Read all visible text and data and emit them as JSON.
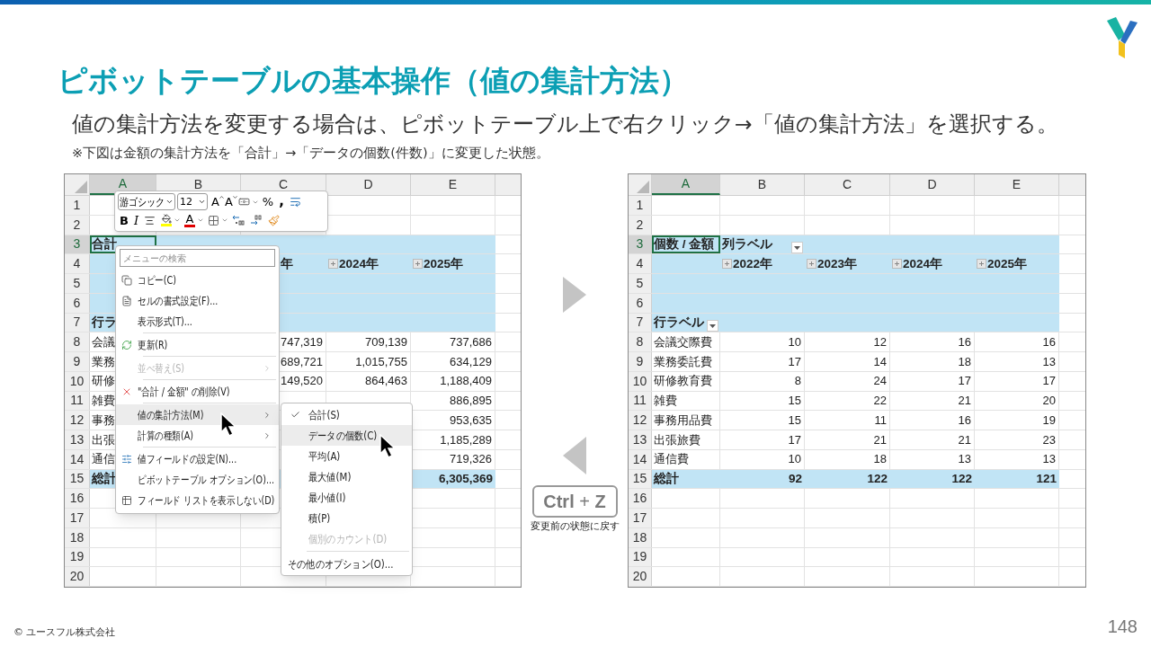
{
  "slide": {
    "title": "ピボットテーブルの基本操作（値の集計方法）",
    "subtitle": "値の集計方法を変更する場合は、ピボットテーブル上で右クリック→「値の集計方法」を選択する。",
    "note": "※下図は金額の集計方法を「合計」→「データの個数(件数)」に変更した状態。",
    "undo_key": "**Ctrl** + **Z**",
    "undo_caption": "変更前の状態に戻す",
    "footer": "© ユースフル株式会社",
    "page": "148"
  },
  "before": {
    "columns": [
      {
        "label": "A",
        "selected": true
      },
      {
        "label": "B",
        "selected": false
      },
      {
        "label": "C",
        "selected": false
      },
      {
        "label": "D",
        "selected": false
      },
      {
        "label": "E",
        "selected": false
      }
    ],
    "rows": [
      {
        "number": "1",
        "selected": false,
        "kind": "blank",
        "cells": [
          null,
          null,
          null,
          null,
          null
        ]
      },
      {
        "number": "2",
        "selected": false,
        "kind": "blank",
        "cells": [
          null,
          null,
          null,
          null,
          null
        ]
      },
      {
        "number": "3",
        "selected": true,
        "kind": "pivot",
        "cells": [
          {
            "text": "合計",
            "active": true
          },
          null,
          null,
          null,
          null
        ]
      },
      {
        "number": "4",
        "selected": false,
        "kind": "pivot",
        "cells": [
          null,
          null,
          {
            "text": "年",
            "kind": "clipped"
          },
          {
            "text": "2024年",
            "expander": true
          },
          {
            "text": "2025年",
            "expander": true
          }
        ]
      },
      {
        "number": "5",
        "selected": false,
        "kind": "pivot",
        "cells": [
          null,
          null,
          null,
          null,
          null
        ]
      },
      {
        "number": "6",
        "selected": false,
        "kind": "pivot",
        "cells": [
          null,
          null,
          null,
          null,
          null
        ]
      },
      {
        "number": "7",
        "selected": false,
        "kind": "pivot",
        "cells": [
          "行ラ",
          null,
          null,
          null,
          null
        ]
      },
      {
        "number": "8",
        "selected": false,
        "kind": "data",
        "cells": [
          "会議",
          null,
          "747,319",
          "709,139",
          "737,686"
        ]
      },
      {
        "number": "9",
        "selected": false,
        "kind": "data",
        "cells": [
          "業務",
          null,
          "689,721",
          "1,015,755",
          "634,129"
        ]
      },
      {
        "number": "10",
        "selected": false,
        "kind": "data",
        "cells": [
          "研修",
          null,
          "149,520",
          "864,463",
          "1,188,409"
        ]
      },
      {
        "number": "11",
        "selected": false,
        "kind": "data",
        "cells": [
          "雑費",
          null,
          null,
          null,
          "886,895"
        ]
      },
      {
        "number": "12",
        "selected": false,
        "kind": "data",
        "cells": [
          "事務",
          null,
          null,
          null,
          "953,635"
        ]
      },
      {
        "number": "13",
        "selected": false,
        "kind": "data",
        "cells": [
          "出張",
          null,
          null,
          null,
          "1,185,289"
        ]
      },
      {
        "number": "14",
        "selected": false,
        "kind": "data",
        "cells": [
          "通信",
          null,
          null,
          null,
          "719,326"
        ]
      },
      {
        "number": "15",
        "selected": false,
        "kind": "total",
        "cells": [
          "総計",
          null,
          null,
          null,
          "6,305,369"
        ]
      },
      {
        "number": "16",
        "selected": false,
        "kind": "blank",
        "cells": [
          null,
          null,
          null,
          null,
          null
        ]
      },
      {
        "number": "17",
        "selected": false,
        "kind": "blank",
        "cells": [
          null,
          null,
          null,
          null,
          null
        ]
      },
      {
        "number": "18",
        "selected": false,
        "kind": "blank",
        "cells": [
          null,
          null,
          null,
          null,
          null
        ]
      },
      {
        "number": "19",
        "selected": false,
        "kind": "blank",
        "cells": [
          null,
          null,
          null,
          null,
          null
        ]
      },
      {
        "number": "20",
        "selected": false,
        "kind": "blank",
        "cells": [
          null,
          null,
          null,
          null,
          null
        ]
      }
    ],
    "mini_toolbar": {
      "font": "游ゴシック",
      "size": "12",
      "grow_font": "A",
      "shrink_font": "A",
      "percent": "%",
      "comma": ",",
      "bold": "B",
      "italic": "I",
      "font_color": "A"
    },
    "context_menu": {
      "search_placeholder": "メニューの検索",
      "items": [
        {
          "kind": "item",
          "label": "コピー(C)",
          "disabled": false,
          "highlighted": false,
          "submenu": false
        },
        {
          "kind": "item",
          "label": "セルの書式設定(F)...",
          "disabled": false,
          "highlighted": false,
          "submenu": false
        },
        {
          "kind": "item",
          "label": "表示形式(T)...",
          "disabled": false,
          "highlighted": false,
          "submenu": false
        },
        {
          "kind": "separator"
        },
        {
          "kind": "item",
          "label": "更新(R)",
          "disabled": false,
          "highlighted": false,
          "submenu": false
        },
        {
          "kind": "separator"
        },
        {
          "kind": "item",
          "label": "並べ替え(S)",
          "disabled": true,
          "highlighted": false,
          "submenu": true
        },
        {
          "kind": "separator"
        },
        {
          "kind": "item",
          "label": "\"合計 / 金額\" の削除(V)",
          "disabled": false,
          "highlighted": false,
          "submenu": false
        },
        {
          "kind": "separator"
        },
        {
          "kind": "item",
          "label": "値の集計方法(M)",
          "disabled": false,
          "highlighted": true,
          "submenu": true
        },
        {
          "kind": "item",
          "label": "計算の種類(A)",
          "disabled": false,
          "highlighted": false,
          "submenu": true
        },
        {
          "kind": "separator"
        },
        {
          "kind": "item",
          "label": "値フィールドの設定(N)...",
          "disabled": false,
          "highlighted": false,
          "submenu": false
        },
        {
          "kind": "item",
          "label": "ピボットテーブル オプション(O)...",
          "disabled": false,
          "highlighted": false,
          "submenu": false
        },
        {
          "kind": "item",
          "label": "フィールド リストを表示しない(D)",
          "disabled": false,
          "highlighted": false,
          "submenu": false
        }
      ]
    },
    "submenu": {
      "items": [
        {
          "kind": "item",
          "label": "合計(S)",
          "checked": true,
          "highlighted": false,
          "disabled": false
        },
        {
          "kind": "item",
          "label": "データの個数(C)",
          "checked": false,
          "highlighted": true,
          "disabled": false
        },
        {
          "kind": "item",
          "label": "平均(A)",
          "checked": false,
          "highlighted": false,
          "disabled": false
        },
        {
          "kind": "item",
          "label": "最大値(M)",
          "checked": false,
          "highlighted": false,
          "disabled": false
        },
        {
          "kind": "item",
          "label": "最小値(I)",
          "checked": false,
          "highlighted": false,
          "disabled": false
        },
        {
          "kind": "item",
          "label": "積(P)",
          "checked": false,
          "highlighted": false,
          "disabled": false
        },
        {
          "kind": "item",
          "label": "個別のカウント(D)",
          "checked": false,
          "highlighted": false,
          "disabled": true
        },
        {
          "kind": "separator"
        },
        {
          "kind": "item",
          "label": "その他のオプション(O)...",
          "checked": false,
          "highlighted": false,
          "disabled": false
        }
      ]
    }
  },
  "after": {
    "columns": [
      {
        "label": "A",
        "selected": true
      },
      {
        "label": "B",
        "selected": false
      },
      {
        "label": "C",
        "selected": false
      },
      {
        "label": "D",
        "selected": false
      },
      {
        "label": "E",
        "selected": false
      }
    ],
    "rows": [
      {
        "number": "1",
        "selected": false,
        "kind": "blank",
        "cells": [
          null,
          null,
          null,
          null,
          null
        ]
      },
      {
        "number": "2",
        "selected": false,
        "kind": "blank",
        "cells": [
          null,
          null,
          null,
          null,
          null
        ]
      },
      {
        "number": "3",
        "selected": true,
        "kind": "pivot",
        "cells": [
          {
            "text": "個数 / 金額",
            "active": true
          },
          {
            "text": "列ラベル",
            "filter": true
          },
          null,
          null,
          null
        ]
      },
      {
        "number": "4",
        "selected": false,
        "kind": "pivot",
        "cells": [
          null,
          {
            "text": "2022年",
            "expander": true
          },
          {
            "text": "2023年",
            "expander": true
          },
          {
            "text": "2024年",
            "expander": true
          },
          {
            "text": "2025年",
            "expander": true
          }
        ]
      },
      {
        "number": "5",
        "selected": false,
        "kind": "pivot",
        "cells": [
          null,
          null,
          null,
          null,
          null
        ]
      },
      {
        "number": "6",
        "selected": false,
        "kind": "pivot",
        "cells": [
          null,
          null,
          null,
          null,
          null
        ]
      },
      {
        "number": "7",
        "selected": false,
        "kind": "pivot",
        "cells": [
          {
            "text": "行ラベル",
            "filter": true
          },
          null,
          null,
          null,
          null
        ]
      },
      {
        "number": "8",
        "selected": false,
        "kind": "data",
        "cells": [
          "会議交際費",
          "10",
          "12",
          "16",
          "16"
        ]
      },
      {
        "number": "9",
        "selected": false,
        "kind": "data",
        "cells": [
          "業務委託費",
          "17",
          "14",
          "18",
          "13"
        ]
      },
      {
        "number": "10",
        "selected": false,
        "kind": "data",
        "cells": [
          "研修教育費",
          "8",
          "24",
          "17",
          "17"
        ]
      },
      {
        "number": "11",
        "selected": false,
        "kind": "data",
        "cells": [
          "雑費",
          "15",
          "22",
          "21",
          "20"
        ]
      },
      {
        "number": "12",
        "selected": false,
        "kind": "data",
        "cells": [
          "事務用品費",
          "15",
          "11",
          "16",
          "19"
        ]
      },
      {
        "number": "13",
        "selected": false,
        "kind": "data",
        "cells": [
          "出張旅費",
          "17",
          "21",
          "21",
          "23"
        ]
      },
      {
        "number": "14",
        "selected": false,
        "kind": "data",
        "cells": [
          "通信費",
          "10",
          "18",
          "13",
          "13"
        ]
      },
      {
        "number": "15",
        "selected": false,
        "kind": "total",
        "cells": [
          "総計",
          "92",
          "122",
          "122",
          "121"
        ]
      },
      {
        "number": "16",
        "selected": false,
        "kind": "blank",
        "cells": [
          null,
          null,
          null,
          null,
          null
        ]
      },
      {
        "number": "17",
        "selected": false,
        "kind": "blank",
        "cells": [
          null,
          null,
          null,
          null,
          null
        ]
      },
      {
        "number": "18",
        "selected": false,
        "kind": "blank",
        "cells": [
          null,
          null,
          null,
          null,
          null
        ]
      },
      {
        "number": "19",
        "selected": false,
        "kind": "blank",
        "cells": [
          null,
          null,
          null,
          null,
          null
        ]
      },
      {
        "number": "20",
        "selected": false,
        "kind": "blank",
        "cells": [
          null,
          null,
          null,
          null,
          null
        ]
      }
    ]
  }
}
